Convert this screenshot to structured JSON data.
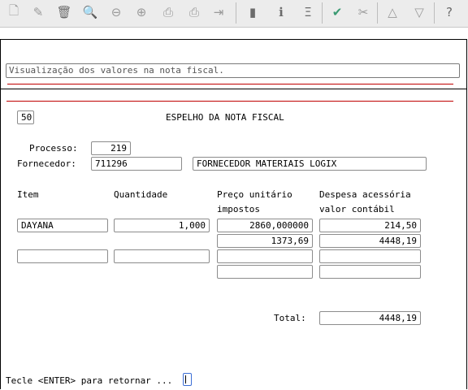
{
  "toolbar": {
    "icons": [
      "new-doc-icon",
      "edit-icon",
      "trash-icon",
      "search-icon",
      "prev-icon",
      "next-icon",
      "print-icon",
      "print2-icon",
      "export-icon",
      "book-icon",
      "info-icon",
      "zoom-icon",
      "check-icon",
      "tools-icon",
      "up-icon",
      "down-icon",
      "help-icon"
    ]
  },
  "message": "Visualização dos valores na nota fiscal.",
  "header": {
    "code": "50",
    "title": "ESPELHO DA NOTA FISCAL"
  },
  "processo": {
    "label": "Processo:",
    "value": "219"
  },
  "fornecedor": {
    "label": "Fornecedor:",
    "code": "711296",
    "name": "FORNECEDOR MATERIAIS LOGIX"
  },
  "columns": {
    "item": "Item",
    "quantidade": "Quantidade",
    "preco": "Preço unitário",
    "impostos": "impostos",
    "despesa": "Despesa acessória",
    "valor": "valor contábil"
  },
  "rows": [
    {
      "item": "DAYANA",
      "quantidade": "1,000",
      "preco": "2860,000000",
      "impostos": "1373,69",
      "despesa": "214,50",
      "valor": "4448,19"
    },
    {
      "item": "",
      "quantidade": "",
      "preco": "",
      "impostos": "",
      "despesa": "",
      "valor": ""
    }
  ],
  "total": {
    "label": "Total:",
    "value": "4448,19"
  },
  "footer": {
    "prompt": "Tecle <ENTER> para retornar ..."
  }
}
